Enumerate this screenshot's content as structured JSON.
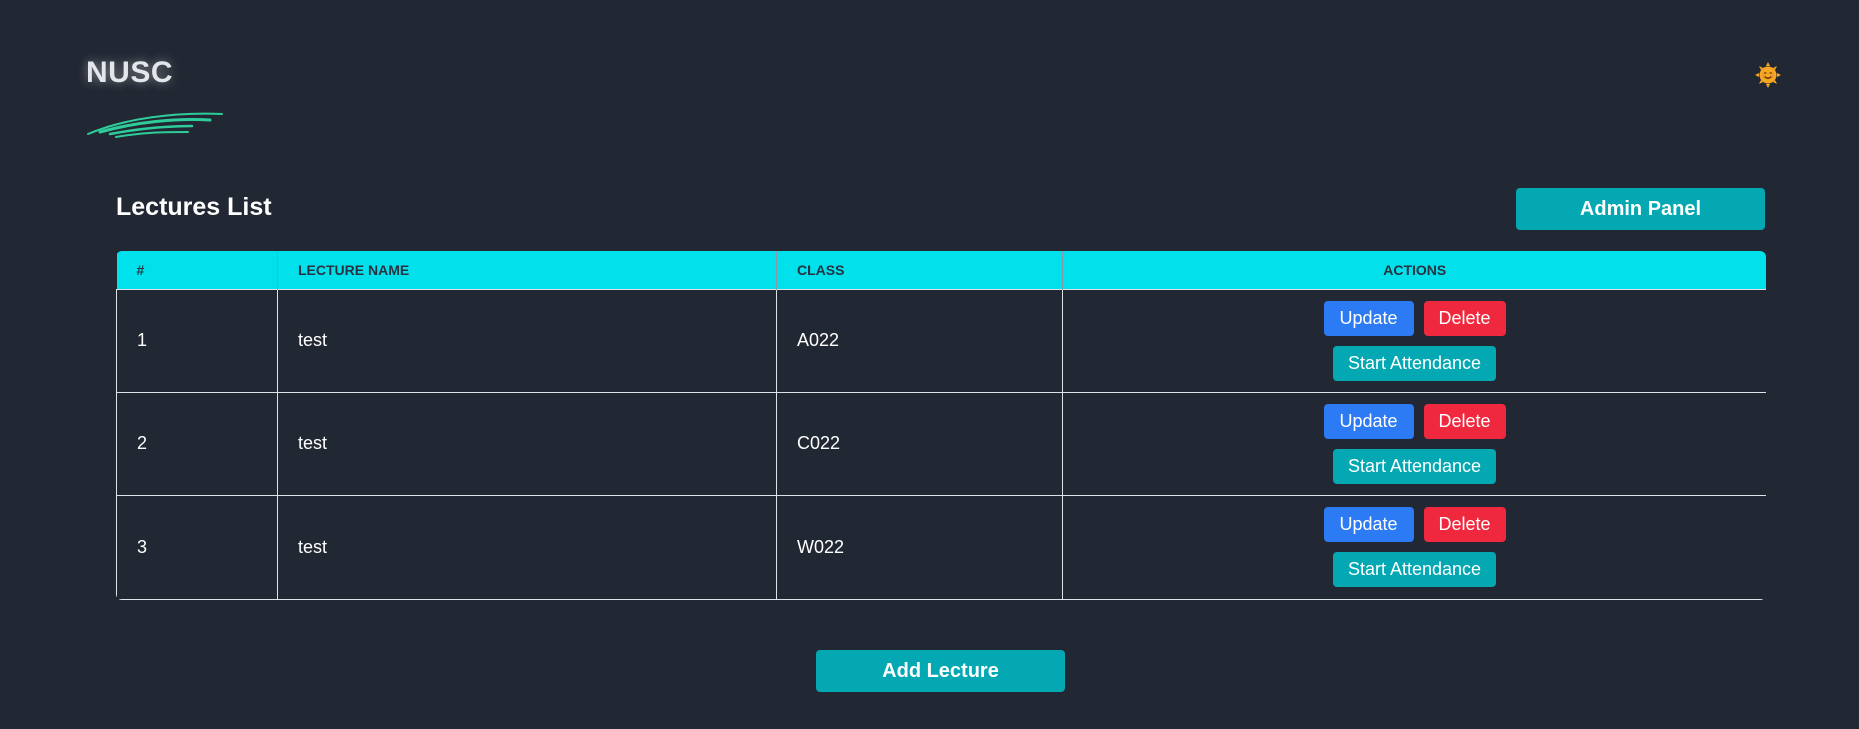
{
  "brand": {
    "title": "NUSC",
    "swoosh_color": "#2ecc9a"
  },
  "theme_toggle": {
    "icon": "smiling-sun-icon",
    "color": "#f5a623"
  },
  "page": {
    "title": "Lectures List",
    "admin_button_label": "Admin Panel",
    "add_button_label": "Add Lecture"
  },
  "table": {
    "headers": [
      "#",
      "LECTURE NAME",
      "CLASS",
      "ACTIONS"
    ],
    "header_color": "#01e1ec",
    "rows": [
      {
        "num": "1",
        "name": "test",
        "class": "A022"
      },
      {
        "num": "2",
        "name": "test",
        "class": "C022"
      },
      {
        "num": "3",
        "name": "test",
        "class": "W022"
      }
    ],
    "actions": {
      "update_label": "Update",
      "delete_label": "Delete",
      "start_label": "Start Attendance"
    }
  },
  "colors": {
    "background": "#222833",
    "teal": "#03a8b3",
    "update_blue": "#2c7bf4",
    "delete_red": "#f0283d"
  }
}
